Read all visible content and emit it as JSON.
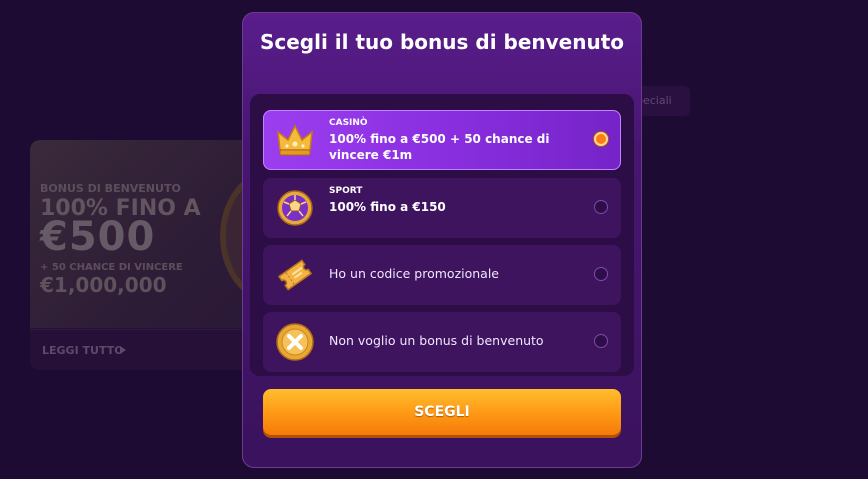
{
  "background": {
    "tab_label": "peciali",
    "banner_lines": [
      "BONUS DI BENVENUTO",
      "100% FINO A",
      "€500",
      "+ 50 CHANCE DI VINCERE",
      "€1,000,000"
    ],
    "cta_label": "LEGGI TUTTO"
  },
  "modal": {
    "title": "Scegli il tuo bonus di benvenuto",
    "options": [
      {
        "category": "CASINÒ",
        "text": "100% fino a €500 + 50 chance di vincere €1m",
        "icon": "crown-icon",
        "selected": true
      },
      {
        "category": "SPORT",
        "text": "100% fino a €150",
        "icon": "soccer-ball-icon",
        "selected": false
      },
      {
        "category": "",
        "text": "Ho un codice promozionale",
        "icon": "ticket-icon",
        "selected": false
      },
      {
        "category": "",
        "text": "Non voglio un bonus di benvenuto",
        "icon": "no-bonus-coin-icon",
        "selected": false
      }
    ],
    "submit_label": "SCEGLI"
  },
  "colors": {
    "modal_bg": "#471671",
    "selected_option": "#8a2fe0",
    "cta": "#ff9b16",
    "radio_on": "#ff7d12"
  }
}
